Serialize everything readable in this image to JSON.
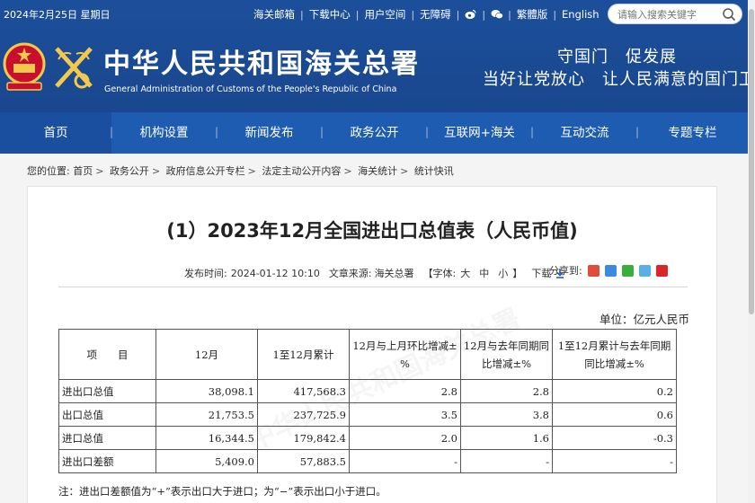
{
  "topbar": {
    "date": "2024年2月25日 星期日",
    "links": [
      "海关邮箱",
      "下载中心",
      "用户空间",
      "无障碍"
    ],
    "lang_links": [
      "繁體版",
      "English"
    ],
    "search_placeholder": "请输入搜索关键字"
  },
  "site": {
    "name_cn": "中华人民共和国海关总署",
    "name_en": "General Administration of Customs of the People's Republic of China",
    "slogan_line1": "守国门　促发展",
    "slogan_line2": "当好让党放心　让人民满意的国门卫士"
  },
  "nav": {
    "items": [
      "首页",
      "机构设置",
      "新闻发布",
      "政务公开",
      "互联网+海关",
      "互动交流",
      "专题专栏"
    ],
    "divider": "|"
  },
  "breadcrumb": {
    "prefix": "您的位置:",
    "items": [
      "首页",
      "政务公开",
      "政府信息公开专栏",
      "法定主动公开内容",
      "海关统计",
      "统计快讯"
    ],
    "separator": ">"
  },
  "article": {
    "title": "(1）2023年12月全国进出口总值表（人民币值)",
    "publish_label": "发布时间:",
    "publish_time": "2024-01-12 10:10",
    "source_label": "文章来源:",
    "source": "海关总署",
    "font_label": "【字体:",
    "font_sizes": [
      "大",
      "中",
      "小"
    ],
    "font_close": "】",
    "download_label": "下载",
    "share_label": "分享到:",
    "unit": "单位：亿元人民币",
    "note": "注：进出口差额值为“+”表示出口大于进口；为“−”表示出口小于进口。"
  },
  "table": {
    "headers": [
      "项　　目",
      "12月",
      "1至12月累计",
      "12月与上月环比增减±%",
      "12月与去年同期同比增减±%",
      "1至12月累计与去年同期同比增减±%"
    ],
    "rows": [
      [
        "进出口总值",
        "38,098.1",
        "417,568.3",
        "2.8",
        "2.8",
        "0.2"
      ],
      [
        "出口总值",
        "21,753.5",
        "237,725.9",
        "3.5",
        "3.8",
        "0.6"
      ],
      [
        "进口总值",
        "16,344.5",
        "179,842.4",
        "2.0",
        "1.6",
        "-0.3"
      ],
      [
        "进出口差额",
        "5,409.0",
        "57,883.5",
        "-",
        "-",
        "-"
      ]
    ]
  },
  "colors": {
    "header_bg": "#1c4f9b",
    "nav_bg": "#1d5cb0",
    "emblem_red": "#c8102e",
    "emblem_gold": "#f2c94c"
  }
}
